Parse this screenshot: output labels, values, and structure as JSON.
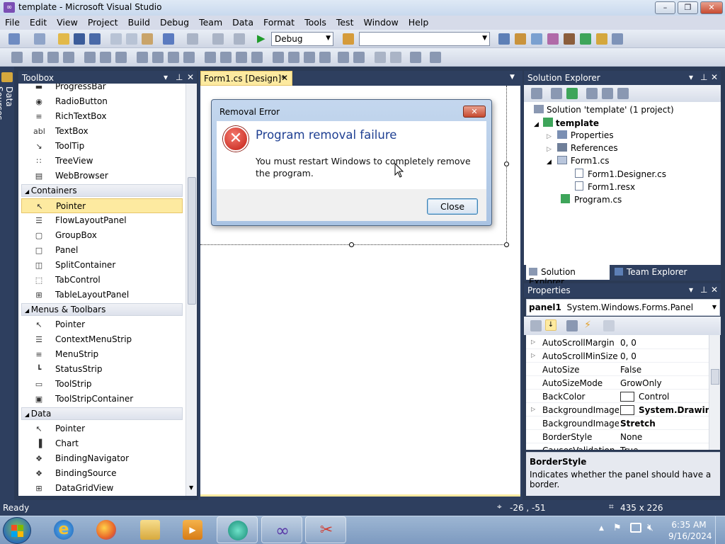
{
  "window": {
    "title": "template - Microsoft Visual Studio",
    "min": "–",
    "max": "❐",
    "close": "✕"
  },
  "menu": [
    "File",
    "Edit",
    "View",
    "Project",
    "Build",
    "Debug",
    "Team",
    "Data",
    "Format",
    "Tools",
    "Test",
    "Window",
    "Help"
  ],
  "toolbar": {
    "config": "Debug",
    "platform": ""
  },
  "side_tab": "Data Sources",
  "toolbox": {
    "title": "Toolbox",
    "items_top": [
      {
        "label": "ProgressBar",
        "icon": "progressbar-icon",
        "glyph": "▬"
      },
      {
        "label": "RadioButton",
        "icon": "radiobutton-icon",
        "glyph": "◉"
      },
      {
        "label": "RichTextBox",
        "icon": "richtextbox-icon",
        "glyph": "≡"
      },
      {
        "label": "TextBox",
        "icon": "textbox-icon",
        "glyph": "abl"
      },
      {
        "label": "ToolTip",
        "icon": "tooltip-icon",
        "glyph": "↘"
      },
      {
        "label": "TreeView",
        "icon": "treeview-icon",
        "glyph": "∷"
      },
      {
        "label": "WebBrowser",
        "icon": "webbrowser-icon",
        "glyph": "▤"
      }
    ],
    "containers_header": "Containers",
    "containers": [
      {
        "label": "Pointer",
        "icon": "pointer-icon",
        "glyph": "↖"
      },
      {
        "label": "FlowLayoutPanel",
        "icon": "flowlayoutpanel-icon",
        "glyph": "☰"
      },
      {
        "label": "GroupBox",
        "icon": "groupbox-icon",
        "glyph": "▢"
      },
      {
        "label": "Panel",
        "icon": "panel-icon",
        "glyph": "□"
      },
      {
        "label": "SplitContainer",
        "icon": "splitcontainer-icon",
        "glyph": "◫"
      },
      {
        "label": "TabControl",
        "icon": "tabcontrol-icon",
        "glyph": "⬚"
      },
      {
        "label": "TableLayoutPanel",
        "icon": "tablelayoutpanel-icon",
        "glyph": "⊞"
      }
    ],
    "menus_header": "Menus & Toolbars",
    "menus": [
      {
        "label": "Pointer",
        "icon": "pointer-icon",
        "glyph": "↖"
      },
      {
        "label": "ContextMenuStrip",
        "icon": "contextmenustrip-icon",
        "glyph": "☰"
      },
      {
        "label": "MenuStrip",
        "icon": "menustrip-icon",
        "glyph": "≡"
      },
      {
        "label": "StatusStrip",
        "icon": "statusstrip-icon",
        "glyph": "┗"
      },
      {
        "label": "ToolStrip",
        "icon": "toolstrip-icon",
        "glyph": "▭"
      },
      {
        "label": "ToolStripContainer",
        "icon": "toolstripcontainer-icon",
        "glyph": "▣"
      }
    ],
    "data_header": "Data",
    "data": [
      {
        "label": "Pointer",
        "icon": "pointer-icon",
        "glyph": "↖"
      },
      {
        "label": "Chart",
        "icon": "chart-icon",
        "glyph": "▐"
      },
      {
        "label": "BindingNavigator",
        "icon": "bindingnavigator-icon",
        "glyph": "❖"
      },
      {
        "label": "BindingSource",
        "icon": "bindingsource-icon",
        "glyph": "❖"
      },
      {
        "label": "DataGridView",
        "icon": "datagridview-icon",
        "glyph": "⊞"
      }
    ]
  },
  "doc_tab": "Form1.cs [Design]*",
  "dialog": {
    "title": "Removal Error",
    "heading": "Program removal failure",
    "message": "You must restart Windows to completely remove the program.",
    "close_button": "Close"
  },
  "solution_explorer": {
    "title": "Solution Explorer",
    "solution": "Solution 'template' (1 project)",
    "project": "template",
    "nodes": [
      "Properties",
      "References",
      "Form1.cs",
      "Form1.Designer.cs",
      "Form1.resx",
      "Program.cs"
    ],
    "tab1": "Solution Explorer",
    "tab2": "Team Explorer"
  },
  "properties": {
    "title": "Properties",
    "object": "panel1",
    "object_type": "System.Windows.Forms.Panel",
    "rows": [
      {
        "name": "AutoScrollMargin",
        "value": "0, 0",
        "expand": true
      },
      {
        "name": "AutoScrollMinSize",
        "value": "0, 0",
        "expand": true
      },
      {
        "name": "AutoSize",
        "value": "False",
        "expand": false
      },
      {
        "name": "AutoSizeMode",
        "value": "GrowOnly",
        "expand": false
      },
      {
        "name": "BackColor",
        "value": "Control",
        "expand": false
      },
      {
        "name": "BackgroundImage",
        "value": "System.Drawing.",
        "expand": true
      },
      {
        "name": "BackgroundImageLa",
        "value": "Stretch",
        "expand": false
      },
      {
        "name": "BorderStyle",
        "value": "None",
        "expand": false
      },
      {
        "name": "CausesValidation",
        "value": "True",
        "expand": false
      }
    ],
    "desc_title": "BorderStyle",
    "desc_text": "Indicates whether the panel should have a border."
  },
  "status": {
    "ready": "Ready",
    "position": "-26 , -51",
    "size": "435 x 226"
  },
  "taskbar": {
    "time": "6:35 AM",
    "date": "9/16/2024"
  }
}
